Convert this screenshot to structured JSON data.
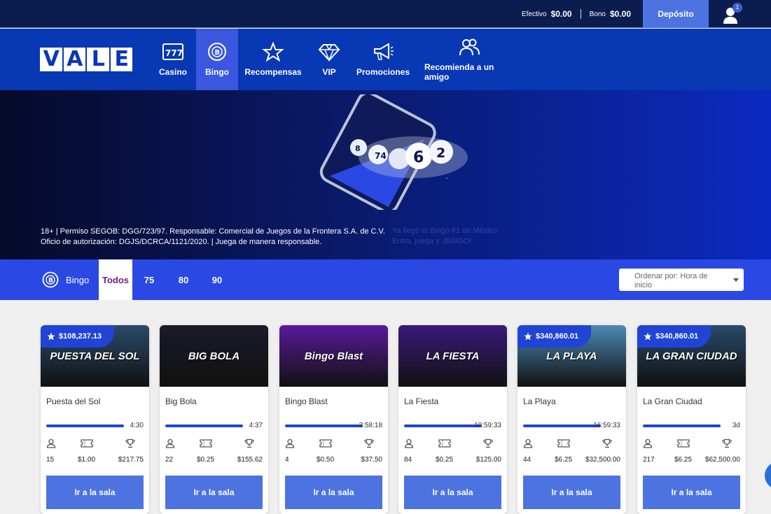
{
  "topbar": {
    "cash_label": "Efectivo",
    "cash_value": "$0.00",
    "bonus_label": "Bono",
    "bonus_value": "$0.00",
    "deposit_label": "Depósito",
    "notification_count": "1"
  },
  "brand": {
    "logo_text": "VALE"
  },
  "nav": {
    "items": [
      {
        "label": "Casino",
        "icon": "slot-777-icon"
      },
      {
        "label": "Bingo",
        "icon": "bingo-ball-icon",
        "active": true
      },
      {
        "label": "Recompensas",
        "icon": "star-icon"
      },
      {
        "label": "VIP",
        "icon": "diamond-icon"
      },
      {
        "label": "Promociones",
        "icon": "megaphone-icon"
      },
      {
        "label": "Recomienda a un amigo",
        "icon": "users-icon"
      }
    ]
  },
  "hero": {
    "legal_line1": "18+ | Permiso SEGOB: DGG/723/97. Responsable: Comercial de Juegos de la Frontera S.A. de C.V.",
    "legal_line2": "Oficio de autorización: DGJS/DCRCA/1121/2020. | Juega de manera responsable.",
    "tagline1": "Ya llegó el Bingo #1 de México",
    "tagline2": "Entra, juega y ¡BINGO!"
  },
  "filters": {
    "section_label": "Bingo",
    "tabs": [
      "Todos",
      "75",
      "80",
      "90"
    ],
    "active_tab": "Todos",
    "sort_label": "Ordenar por: Hora de inicio"
  },
  "rooms": [
    {
      "name": "Puesta del Sol",
      "image_text": "PUESTA DEL SOL",
      "jackpot": "$108,237.13",
      "time": "4:30",
      "players": "15",
      "ticket": "$1.00",
      "prize": "$217.75",
      "button": "Ir a la sala",
      "bg": "#2b4a6a"
    },
    {
      "name": "Big Bola",
      "image_text": "BIG BOLA",
      "jackpot": null,
      "time": "4:37",
      "players": "22",
      "ticket": "$0.25",
      "prize": "$155.62",
      "button": "Ir a la sala",
      "bg": "#1a1a2a"
    },
    {
      "name": "Bingo Blast",
      "image_text": "Bingo Blast",
      "jackpot": null,
      "time": "3:58:18",
      "players": "4",
      "ticket": "$0.50",
      "prize": "$37.50",
      "button": "Ir a la sala",
      "bg": "#5a1a9a"
    },
    {
      "name": "La Fiesta",
      "image_text": "LA FIESTA",
      "jackpot": null,
      "time": "10:59:33",
      "players": "84",
      "ticket": "$0.25",
      "prize": "$125.00",
      "button": "Ir a la sala",
      "bg": "#3a1a7a"
    },
    {
      "name": "La Playa",
      "image_text": "LA PLAYA",
      "jackpot": "$340,860.01",
      "time": "16:59:33",
      "players": "44",
      "ticket": "$6.25",
      "prize": "$32,500.00",
      "button": "Ir a la sala",
      "bg": "#4a8ab4"
    },
    {
      "name": "La Gran Ciudad",
      "image_text": "LA GRAN CIUDAD",
      "jackpot": "$340,860.01",
      "time": "3d",
      "players": "217",
      "ticket": "$6.25",
      "prize": "$62,500.00",
      "button": "Ir a la sala",
      "bg": "#2a4a6a"
    }
  ]
}
